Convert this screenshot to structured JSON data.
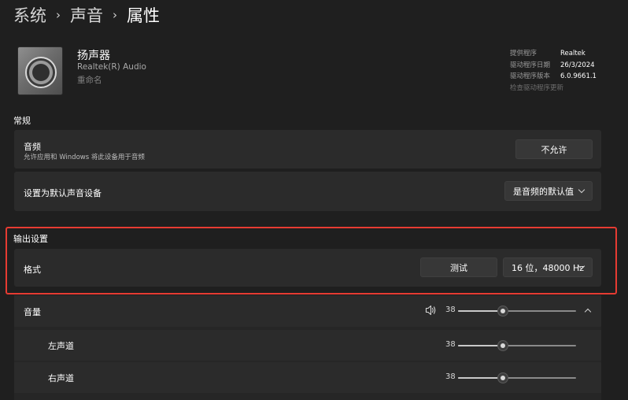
{
  "breadcrumb": {
    "items": [
      "系统",
      "声音",
      "属性"
    ]
  },
  "device": {
    "name": "扬声器",
    "subtitle": "Realtek(R) Audio",
    "rename": "重命名",
    "icon": "speaker-device-icon"
  },
  "driver": {
    "provider_label": "提供程序",
    "provider_value": "Realtek",
    "date_label": "驱动程序日期",
    "date_value": "26/3/2024",
    "version_label": "驱动程序版本",
    "version_value": "6.0.9661.1",
    "update_link": "检查驱动程序更新"
  },
  "general": {
    "section_label": "常规",
    "audio_title": "音频",
    "audio_desc": "允许应用和 Windows 将此设备用于音频",
    "audio_button": "不允许",
    "default_title": "设置为默认声音设备",
    "default_value": "是音频的默认值"
  },
  "output": {
    "section_label": "输出设置",
    "format_title": "格式",
    "test_button": "测试",
    "format_value": "16 位，48000 Hz"
  },
  "volume": {
    "title": "音量",
    "value": 38,
    "level_percent": 38,
    "left_label": "左声道",
    "left_value": 38,
    "right_label": "右声道",
    "right_value": 38,
    "speaker_icon": "volume-speaker-icon",
    "collapse_icon": "chevron-up-icon"
  },
  "colors": {
    "background": "#1f1f1f",
    "card": "#2b2b2b",
    "highlight": "#e63b32"
  }
}
